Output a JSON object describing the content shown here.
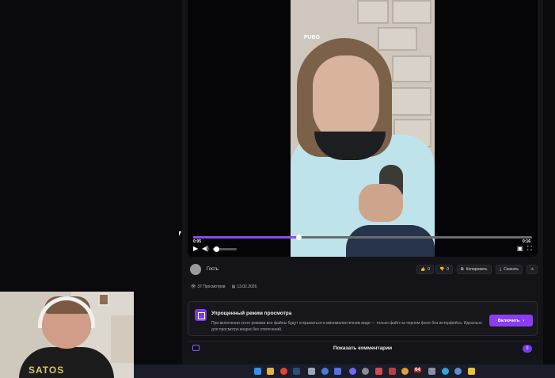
{
  "player": {
    "current_time": "0:05",
    "duration": "0:16",
    "progress": 0.31,
    "volume": 0.12,
    "logo_text": "PUBG"
  },
  "post": {
    "author": "Гость",
    "likes": "0",
    "dislikes": "0",
    "copy_label": "Копировать",
    "download_label": "Скачать",
    "views": "37 Просмотров",
    "date": "13.02.2026"
  },
  "simple_mode": {
    "title": "Упрощенный режим просмотра",
    "description": "При включении этого режима все файлы будут открываться в минималистичном виде — только файл на черном фоне без интерфейса. Идеально для просмотра медиа без отвлечений.",
    "button_label": "Включить"
  },
  "comments": {
    "label": "Показать комментарии",
    "count": "0"
  },
  "webcam": {
    "shirt_text": "SATOS"
  },
  "taskbar": {
    "badge_text": "64"
  },
  "colors": {
    "accent": "#8b3df0",
    "background": "#0a0a0c",
    "panel": "#141418"
  }
}
